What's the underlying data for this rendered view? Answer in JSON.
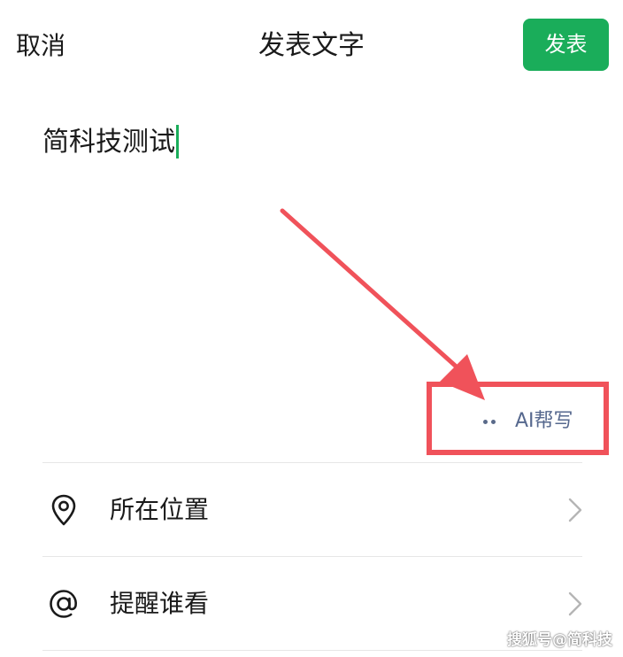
{
  "header": {
    "cancel_label": "取消",
    "title": "发表文字",
    "publish_label": "发表"
  },
  "editor": {
    "text": "简科技测试"
  },
  "ai_help": {
    "label": "AI帮写"
  },
  "options": [
    {
      "label": "所在位置",
      "icon": "location-pin-icon"
    },
    {
      "label": "提醒谁看",
      "icon": "at-sign-icon"
    }
  ],
  "watermark": "搜狐号@简科技",
  "colors": {
    "accent": "#1aad5a",
    "annotation": "#f0525a",
    "ai_text": "#56688e"
  }
}
